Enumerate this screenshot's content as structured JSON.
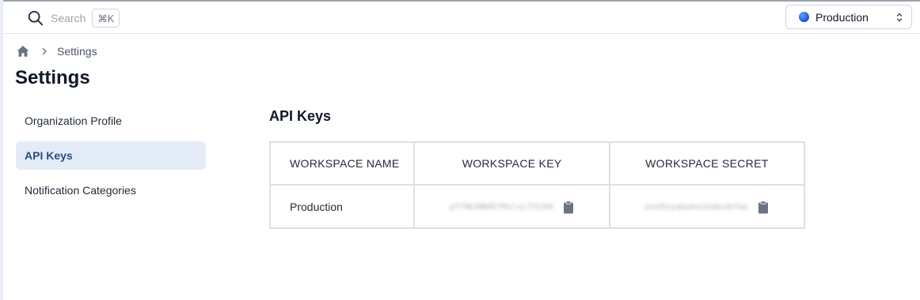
{
  "search": {
    "placeholder": "Search",
    "shortcut": "⌘K"
  },
  "environment": {
    "selected": "Production",
    "dot_color": "#2563eb"
  },
  "breadcrumb": {
    "items": [
      "Settings"
    ]
  },
  "page": {
    "title": "Settings"
  },
  "sidebar": {
    "items": [
      {
        "label": "Organization Profile",
        "active": false
      },
      {
        "label": "API Keys",
        "active": true
      },
      {
        "label": "Notification Categories",
        "active": false
      }
    ]
  },
  "main": {
    "section_title": "API Keys",
    "table": {
      "headers": [
        "WORKSPACE NAME",
        "WORKSPACE KEY",
        "WORKSPACE SECRET"
      ],
      "rows": [
        {
          "workspace_name": "Production",
          "workspace_key": "pTfNCRB6ETMxlxLTVCKH",
          "workspace_secret": "ennEeyabahe2edeubfwe"
        }
      ]
    }
  },
  "icons": {
    "search": "search-icon",
    "home": "home-icon",
    "breadcrumb_separator": "chevron-right-icon",
    "environment_toggle": "chevron-up-down-icon",
    "copy": "clipboard-icon"
  },
  "colors": {
    "accent": "#2a4a86",
    "active_bg": "#e3ebf7",
    "border": "#e0e0e0"
  }
}
